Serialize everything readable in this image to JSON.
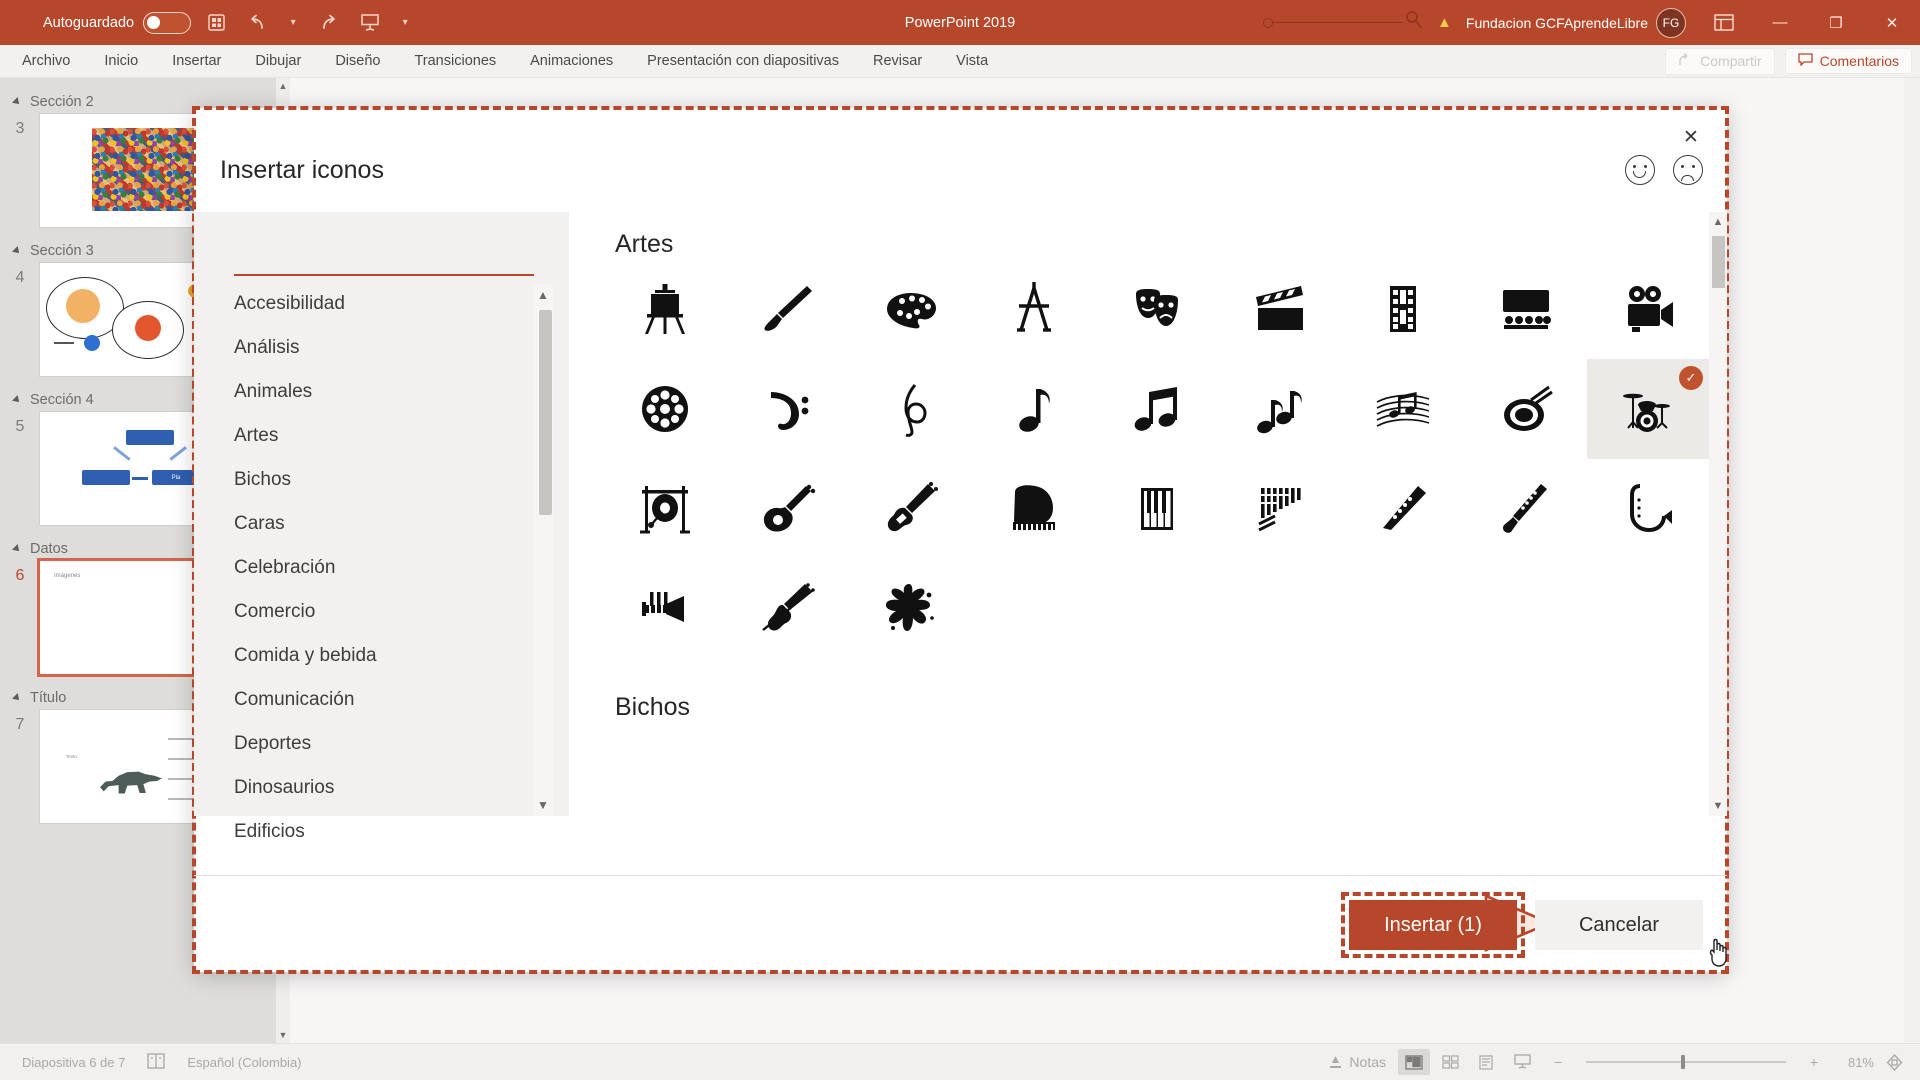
{
  "titlebar": {
    "autosave_label": "Autoguardado",
    "autosave_state": "off",
    "app_title": "PowerPoint 2019",
    "user_name": "Fundacion GCFAprendeLibre",
    "avatar_initials": "FG",
    "icons": [
      "save-icon",
      "undo-icon",
      "undo-dropdown-icon",
      "redo-icon",
      "presentation-icon",
      "more-commands-icon"
    ],
    "search_icon": "search-icon",
    "warning_icon": "warning-icon",
    "window_buttons": [
      "minimize-icon",
      "restore-icon",
      "close-icon"
    ],
    "bg_color": "#b7472a"
  },
  "ribbon": {
    "tabs": [
      "Archivo",
      "Inicio",
      "Insertar",
      "Dibujar",
      "Diseño",
      "Transiciones",
      "Animaciones",
      "Presentación con diapositivas",
      "Revisar",
      "Vista"
    ],
    "share_label": "Compartir",
    "comments_label": "Comentarios",
    "accent_color": "#b7472a"
  },
  "slide_panel": {
    "groups": [
      {
        "section": "Sección 2",
        "slides": [
          {
            "number": "3",
            "thumb": "confetti"
          }
        ]
      },
      {
        "section": "Sección 3",
        "slides": [
          {
            "number": "4",
            "thumb": "circles"
          }
        ]
      },
      {
        "section": "Sección 4",
        "slides": [
          {
            "number": "5",
            "thumb": "hierarchy"
          }
        ]
      },
      {
        "section": "Datos",
        "slides": [
          {
            "number": "6",
            "thumb": "blank-titled",
            "current": true
          }
        ]
      },
      {
        "section": "Título",
        "slides": [
          {
            "number": "7",
            "thumb": "dino"
          }
        ]
      }
    ]
  },
  "dialog": {
    "title": "Insertar iconos",
    "close_icon": "close-icon",
    "feedback": {
      "happy_icon": "happy-face-icon",
      "sad_icon": "sad-face-icon"
    },
    "categories": [
      "Accesibilidad",
      "Análisis",
      "Animales",
      "Artes",
      "Bichos",
      "Caras",
      "Celebración",
      "Comercio",
      "Comida y bebida",
      "Comunicación",
      "Deportes",
      "Dinosaurios",
      "Edificios"
    ],
    "selected_category": "Artes",
    "group_heading": "Artes",
    "next_group_heading": "Bichos",
    "icon_rows": [
      [
        "easel-icon",
        "paintbrush-icon",
        "palette-icon",
        "compass-icon",
        "theater-masks-icon",
        "clapperboard-icon",
        "film-strip-icon",
        "cinema-seats-icon",
        "movie-camera-icon"
      ],
      [
        "film-reel-icon",
        "bass-clef-icon",
        "treble-clef-icon",
        "eighth-note-icon",
        "beamed-eighth-notes-icon",
        "beamed-notes-icon",
        "music-staff-icon",
        "drum-icon",
        "drum-kit-icon"
      ],
      [
        "gong-icon",
        "acoustic-guitar-icon",
        "electric-guitar-icon",
        "grand-piano-icon",
        "piano-keys-icon",
        "pan-flute-icon",
        "flute-icon",
        "clarinet-icon",
        "saxophone-icon"
      ],
      [
        "trumpet-icon",
        "violin-icon",
        "paint-splatter-icon"
      ]
    ],
    "selected_icon": "drum-kit-icon",
    "selected_icon_row": 1,
    "selected_icon_col": 8,
    "selected_count": 1,
    "insert_label": "Insertar (1)",
    "cancel_label": "Cancelar",
    "accent_color": "#b7472a",
    "highlight_border_color": "#b7472a"
  },
  "statusbar": {
    "slide_indicator": "Diapositiva 6 de 7",
    "accessibility_icon": "accessibility-icon",
    "language": "Español (Colombia)",
    "notes_label": "Notas",
    "notes_icon": "notes-icon",
    "view_buttons": [
      "normal-view-icon",
      "slide-sorter-icon",
      "reading-view-icon",
      "slideshow-icon"
    ],
    "active_view": "normal-view-icon",
    "zoom_out_icon": "minus-icon",
    "zoom_in_icon": "plus-icon",
    "zoom_level": "81%",
    "fit_icon": "fit-to-window-icon"
  }
}
